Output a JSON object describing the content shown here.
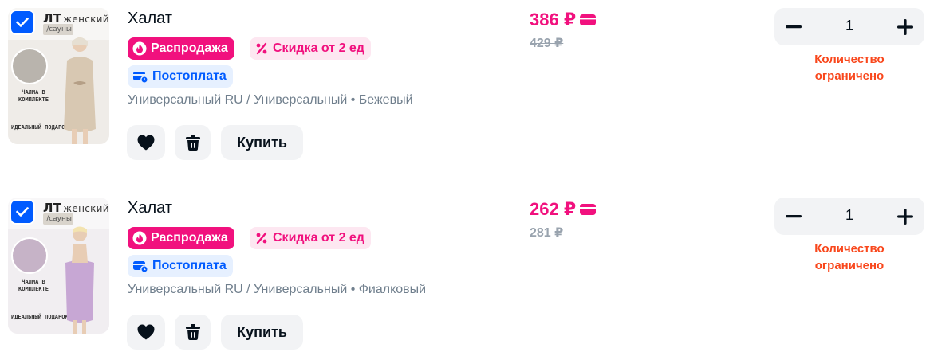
{
  "cart": {
    "items": [
      {
        "name": "Халат",
        "image_overlay": {
          "title_big": "ЛТ",
          "title_small": "женский",
          "plate": "/сауны",
          "promo": "ЧАЛМА В КОМПЛЕКТЕ",
          "gift": "ИДЕАЛЬНЫЙ ПОДАРОК"
        },
        "badges": {
          "sale": "Распродажа",
          "discount": "Скидка от 2 ед",
          "postpay": "Постоплата"
        },
        "attributes": "Универсальный RU / Универсальный • Бежевый",
        "price": "386 ₽",
        "old_price": "429 ₽",
        "quantity": "1",
        "limit_notice": "Количество ограничено",
        "buy_label": "Купить",
        "selected": true
      },
      {
        "name": "Халат",
        "image_overlay": {
          "title_big": "ЛТ",
          "title_small": "женский",
          "plate": "/сауны",
          "promo": "ЧАЛМА В КОМПЛЕКТЕ",
          "gift": "ИДЕАЛЬНЫЙ ПОДАРОК"
        },
        "badges": {
          "sale": "Распродажа",
          "discount": "Скидка от 2 ед",
          "postpay": "Постоплата"
        },
        "attributes": "Универсальный RU / Универсальный • Фиалковый",
        "price": "262 ₽",
        "old_price": "281 ₽",
        "quantity": "1",
        "limit_notice": "Количество ограничено",
        "buy_label": "Купить",
        "selected": true
      }
    ]
  },
  "colors": {
    "brand_blue": "#005bff",
    "price_pink": "#f1117e",
    "limit_red": "#f9471c",
    "muted_gray": "#707f8d",
    "button_bg": "#f2f3f5"
  },
  "icons": {
    "checkbox": "check-icon",
    "sale_badge": "fire-icon",
    "discount_badge": "percent-icon",
    "postpay_badge": "card-clock-icon",
    "price": "ozon-card-icon",
    "like": "heart-icon",
    "delete": "trash-icon",
    "decrement": "minus-icon",
    "increment": "plus-icon"
  }
}
